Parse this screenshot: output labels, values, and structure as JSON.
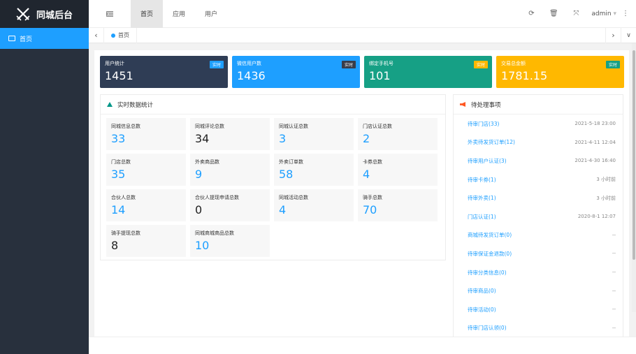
{
  "app": {
    "title": "同城后台"
  },
  "sidebar": {
    "items": [
      {
        "label": "首页"
      }
    ]
  },
  "header": {
    "tabs": [
      {
        "label": "首页"
      },
      {
        "label": "应用"
      },
      {
        "label": "用户"
      }
    ],
    "user": "admin"
  },
  "page_tabs": [
    {
      "label": "首页"
    }
  ],
  "cards": [
    {
      "title": "用户统计",
      "value": "1451",
      "badge": "实时",
      "bg": "#2f3d55",
      "badge_bg": "#1e9fff"
    },
    {
      "title": "微信用户数",
      "value": "1436",
      "badge": "实时",
      "bg": "#1e9fff",
      "badge_bg": "#393d49"
    },
    {
      "title": "绑定手机号",
      "value": "101",
      "badge": "实时",
      "bg": "#16a085",
      "badge_bg": "#ffb800"
    },
    {
      "title": "交易总金额",
      "value": "1781.15",
      "badge": "实时",
      "bg": "#ffb800",
      "badge_bg": "#16a085"
    }
  ],
  "stats": {
    "title": "实时数据统计",
    "items": [
      {
        "label": "同城信息总数",
        "value": "33",
        "color": "blue"
      },
      {
        "label": "同城评论总数",
        "value": "34",
        "color": "dark"
      },
      {
        "label": "同城认证总数",
        "value": "3",
        "color": "blue"
      },
      {
        "label": "门店认证总数",
        "value": "2",
        "color": "blue"
      },
      {
        "label": "门店总数",
        "value": "35",
        "color": "blue"
      },
      {
        "label": "外卖商品数",
        "value": "9",
        "color": "blue"
      },
      {
        "label": "外卖订单数",
        "value": "58",
        "color": "blue"
      },
      {
        "label": "卡券总数",
        "value": "4",
        "color": "blue"
      },
      {
        "label": "合伙人总数",
        "value": "14",
        "color": "blue"
      },
      {
        "label": "合伙人提现申请总数",
        "value": "0",
        "color": "dark"
      },
      {
        "label": "同城活动总数",
        "value": "4",
        "color": "blue"
      },
      {
        "label": "骑手总数",
        "value": "70",
        "color": "blue"
      },
      {
        "label": "骑手提现总数",
        "value": "8",
        "color": "dark"
      },
      {
        "label": "同城商城商品总数",
        "value": "10",
        "color": "blue"
      }
    ]
  },
  "todo": {
    "title": "待处理事项",
    "items": [
      {
        "label": "待审门店(33)",
        "time": "2021-5-18 23:00"
      },
      {
        "label": "外卖待发货订单(12)",
        "time": "2021-4-11 12:04"
      },
      {
        "label": "待审用户认证(3)",
        "time": "2021-4-30 16:40"
      },
      {
        "label": "待审卡券(1)",
        "time": "3 小时前"
      },
      {
        "label": "待审外卖(1)",
        "time": "3 小时前"
      },
      {
        "label": "门店认证(1)",
        "time": "2020-8-1 12:07"
      },
      {
        "label": "商城待发货订单(0)",
        "time": "--"
      },
      {
        "label": "待审保证金退款(0)",
        "time": "--"
      },
      {
        "label": "待审分类信息(0)",
        "time": "--"
      },
      {
        "label": "待审商品(0)",
        "time": "--"
      },
      {
        "label": "待审活动(0)",
        "time": "--"
      },
      {
        "label": "待审门店认领(0)",
        "time": "--"
      }
    ]
  }
}
